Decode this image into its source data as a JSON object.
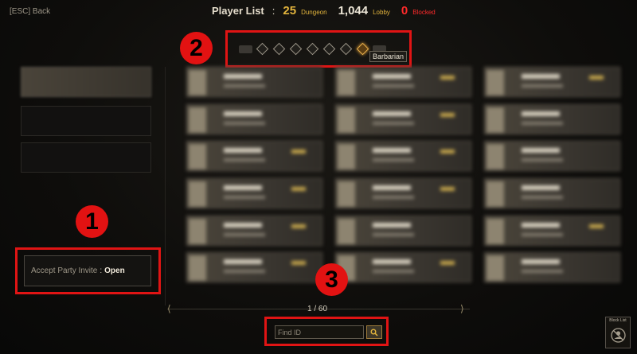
{
  "header": {
    "back_label": "[ESC] Back",
    "title": "Player List",
    "colon": ":",
    "dungeon_count": "25",
    "dungeon_label": "Dungeon",
    "lobby_count": "1,044",
    "lobby_label": "Lobby",
    "blocked_count": "0",
    "blocked_label": "Blocked"
  },
  "class_filter": {
    "tooltip": "Barbarian",
    "selected": "Barbarian"
  },
  "left_panel": {
    "accept_party_invite_label": "Accept Party Invite",
    "accept_party_invite_sep": ":",
    "accept_party_invite_value": "Open"
  },
  "pagination": {
    "page": "1 / 60"
  },
  "search": {
    "placeholder": "Find ID"
  },
  "block_list": {
    "label": "Block List"
  },
  "markers": [
    "1",
    "2",
    "3"
  ],
  "colors": {
    "accent_gold": "#e3b43d",
    "blocked_red": "#ff2a2a",
    "annotation_red": "#e01414"
  }
}
